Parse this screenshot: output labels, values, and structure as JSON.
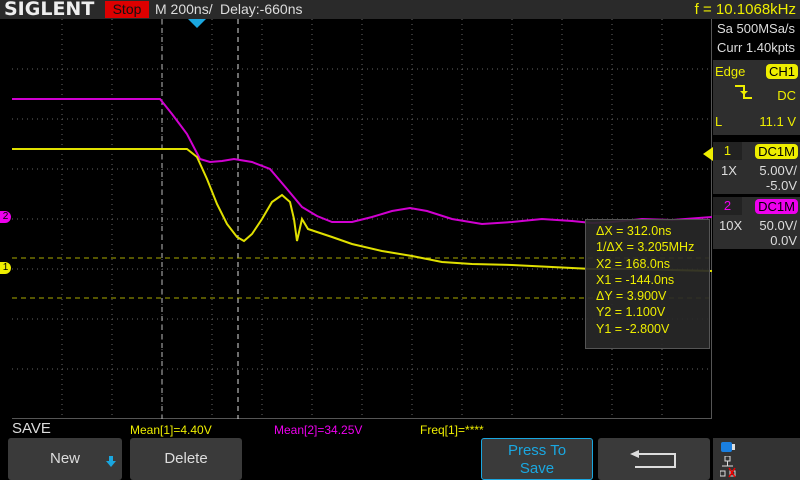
{
  "header": {
    "brand": "SIGLENT",
    "run_state": "Stop",
    "timebase": "M 200ns/",
    "delay": "Delay:-660ns",
    "frequency": "f = 10.1068kHz"
  },
  "acquisition": {
    "sample_rate": "Sa 500MSa/s",
    "memory": "Curr 1.40kpts"
  },
  "trigger": {
    "type": "Edge",
    "source": "CH1",
    "coupling": "DC",
    "level_label": "L",
    "level": "11.1 V",
    "slope_icon": "falling-edge-icon"
  },
  "channels": [
    {
      "number": "1",
      "coupling": "DC1M",
      "probe": "1X",
      "scale": "5.00V/",
      "offset": "-5.0V",
      "color": "#e8e800"
    },
    {
      "number": "2",
      "coupling": "DC1M",
      "probe": "10X",
      "scale": "50.0V/",
      "offset": "0.0V",
      "color": "#e000e0"
    }
  ],
  "cursors": {
    "dx": "ΔX = 312.0ns",
    "inv_dx": "1/ΔX = 3.205MHz",
    "x2": "X2 = 168.0ns",
    "x1": "X1 = -144.0ns",
    "dy": "ΔY = 3.900V",
    "y2": "Y2 = 1.100V",
    "y1": "Y1 = -2.800V"
  },
  "markers": {
    "ch1": "1",
    "ch2": "2"
  },
  "measurements": {
    "mean1": "Mean[1]=4.40V",
    "mean2": "Mean[2]=34.25V",
    "freq1": "Freq[1]=****"
  },
  "menu": {
    "title": "SAVE",
    "new": "New",
    "delete": "Delete",
    "press_to_save_1": "Press To",
    "press_to_save_2": "Save"
  }
}
